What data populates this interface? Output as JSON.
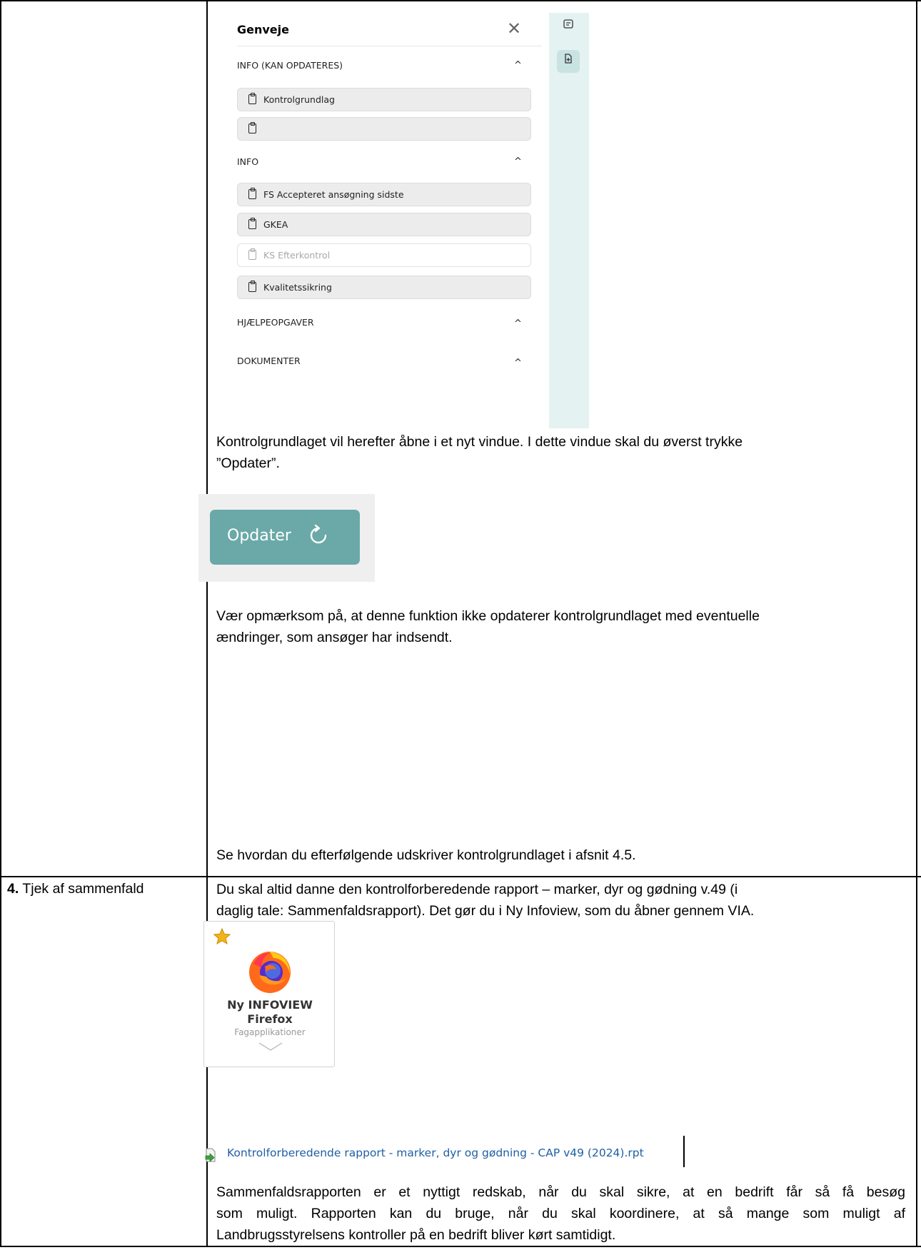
{
  "panel": {
    "title": "Genveje",
    "close_glyph": "✕",
    "sections": [
      {
        "title": "INFO (KAN OPDATERES)",
        "chevron": "^"
      },
      {
        "title": "INFO",
        "chevron": "^"
      },
      {
        "title": "HJÆLPEOPGAVER",
        "chevron": "^"
      },
      {
        "title": "DOKUMENTER",
        "chevron": "^"
      }
    ],
    "items": [
      {
        "label": "Kontrolgrundlag",
        "disabled": false
      },
      {
        "label": "",
        "disabled": false
      },
      {
        "label": "FS Accepteret ansøgning sidste",
        "disabled": false
      },
      {
        "label": "GKEA",
        "disabled": false
      },
      {
        "label": "KS Efterkontrol",
        "disabled": true
      },
      {
        "label": "Kvalitetssikring",
        "disabled": false
      }
    ],
    "side_icons": [
      "notes-icon",
      "add-document-icon"
    ]
  },
  "text": {
    "p1a": "Kontrolgrundlaget vil herefter åbne i et nyt vindue. I dette vindue skal du øverst trykke",
    "p1b": "”Opdater”.",
    "p2a": "Vær opmærksom på, at denne funktion ikke opdaterer kontrolgrundlaget med eventuelle",
    "p2b": "ændringer, som ansøger har indsendt.",
    "p3": "Se hvordan du efterfølgende udskriver kontrolgrundlaget i afsnit 4.5.",
    "p4a": "Du skal altid danne den kontrolforberedende rapport – marker, dyr og gødning v.49 (i",
    "p4b": "daglig tale: Sammenfaldsrapport). Det gør du i Ny Infoview, som du åbner gennem VIA.",
    "p5a": "Sammenfaldsrapporten er et nyttigt redskab, når du skal sikre, at en bedrift får så få besøg",
    "p5b": "som muligt. Rapporten kan du bruge, når du skal koordinere, at så mange som muligt af",
    "p5c": "Landbrugsstyrelsens kontroller på en bedrift bliver kørt samtidigt."
  },
  "row4": {
    "number": "4.",
    "label": "Tjek af sammenfald"
  },
  "update_button": {
    "label": "Opdater",
    "color": "#6aa9a7"
  },
  "tile": {
    "name_line1": "Ny INFOVIEW",
    "name_line2": "Firefox",
    "category": "Fagapplikationer"
  },
  "report": {
    "filename": "Kontrolforberedende rapport - marker, dyr og gødning - CAP v49 (2024).rpt",
    "color": "#1f5fa6"
  }
}
